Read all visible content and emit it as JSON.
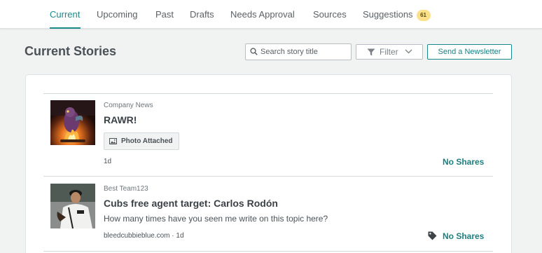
{
  "tabs": [
    {
      "label": "Current"
    },
    {
      "label": "Upcoming"
    },
    {
      "label": "Past"
    },
    {
      "label": "Drafts"
    },
    {
      "label": "Needs Approval"
    },
    {
      "label": "Sources"
    },
    {
      "label": "Suggestions",
      "badge": "61"
    }
  ],
  "colors": {
    "accent": "#1b8a8a",
    "badge": "#fbe08c"
  },
  "header": {
    "title": "Current Stories",
    "search_placeholder": "Search story title",
    "filter_label": "Filter",
    "newsletter_label": "Send a Newsletter"
  },
  "stories": [
    {
      "category": "Company News",
      "title": "RAWR!",
      "attachment": "Photo Attached",
      "meta": "1d",
      "shares": "No Shares",
      "thumb_icon": "dragon-campfire-image"
    },
    {
      "category": "Best Team123",
      "title": "Cubs free agent target: Carlos Rodón",
      "description": "How many times have you seen me write on this topic here?",
      "meta": "bleedcubbieblue.com · 1d",
      "shares": "No Shares",
      "thumb_icon": "baseball-pitcher-image"
    }
  ]
}
